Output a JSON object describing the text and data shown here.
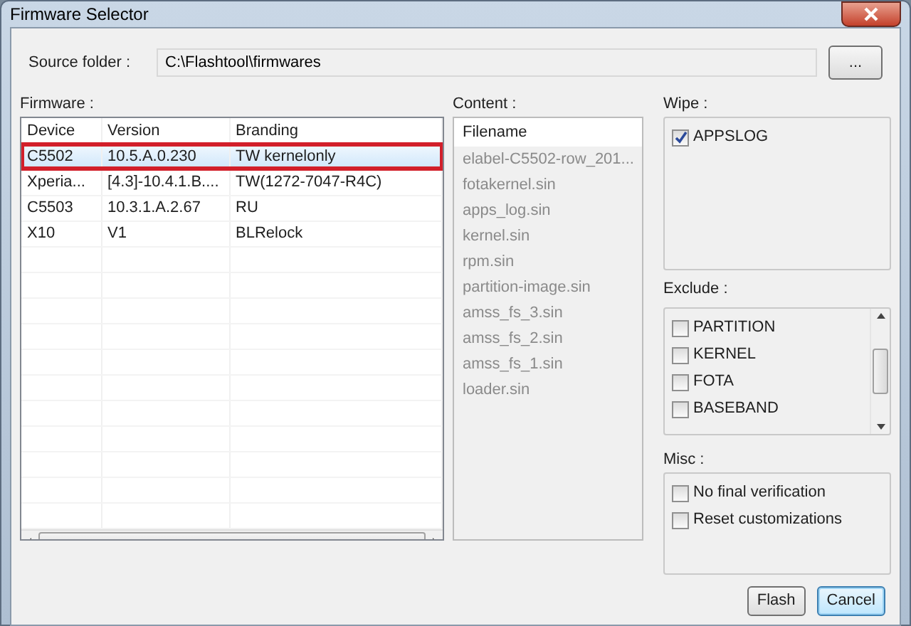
{
  "window": {
    "title": "Firmware Selector"
  },
  "source_folder": {
    "label": "Source folder :",
    "value": "C:\\Flashtool\\firmwares",
    "browse_button": "..."
  },
  "firmware": {
    "label": "Firmware :",
    "columns": [
      "Device",
      "Version",
      "Branding"
    ],
    "rows": [
      {
        "cells": [
          "C5502",
          "10.5.A.0.230",
          "TW kernelonly"
        ],
        "selected": true
      },
      {
        "cells": [
          "Xperia...",
          "[4.3]-10.4.1.B....",
          "TW(1272-7047-R4C)"
        ],
        "selected": false
      },
      {
        "cells": [
          "C5503",
          "10.3.1.A.2.67",
          "RU"
        ],
        "selected": false
      },
      {
        "cells": [
          "X10",
          "V1",
          "BLRelock"
        ],
        "selected": false
      }
    ]
  },
  "content": {
    "label": "Content :",
    "column": "Filename",
    "files": [
      "elabel-C5502-row_201...",
      "fotakernel.sin",
      "apps_log.sin",
      "kernel.sin",
      "rpm.sin",
      "partition-image.sin",
      "amss_fs_3.sin",
      "amss_fs_2.sin",
      "amss_fs_1.sin",
      "loader.sin"
    ]
  },
  "wipe": {
    "label": "Wipe :",
    "items": [
      {
        "label": "APPSLOG",
        "checked": true
      }
    ]
  },
  "exclude": {
    "label": "Exclude :",
    "items": [
      {
        "label": "PARTITION",
        "checked": false
      },
      {
        "label": "KERNEL",
        "checked": false
      },
      {
        "label": "FOTA",
        "checked": false
      },
      {
        "label": "BASEBAND",
        "checked": false
      }
    ]
  },
  "misc": {
    "label": "Misc :",
    "items": [
      {
        "label": "No final verification",
        "checked": false
      },
      {
        "label": "Reset customizations",
        "checked": false
      }
    ]
  },
  "buttons": [
    {
      "label": "Flash",
      "default": false
    },
    {
      "label": "Cancel",
      "default": true
    }
  ]
}
